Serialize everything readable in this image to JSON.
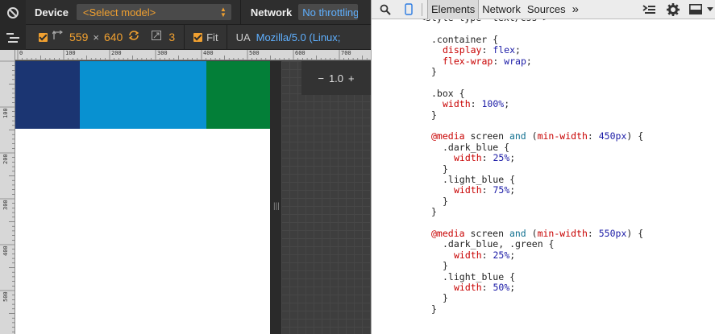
{
  "device_bar": {
    "device_label": "Device",
    "model_select": "<Select model>",
    "network_label": "Network",
    "network_select": "No throttling",
    "width": "559",
    "times": "×",
    "height": "640",
    "scale": "3",
    "fit_label": "Fit",
    "ua_label": "UA",
    "ua_value": "Mozilla/5.0 (Linux;"
  },
  "ruler": {
    "top": [
      "0",
      "100",
      "200",
      "300",
      "400",
      "500",
      "600",
      "700"
    ],
    "left": [
      "100",
      "200",
      "300",
      "400",
      "500"
    ]
  },
  "zoom": {
    "minus": "−",
    "value": "1.0",
    "plus": "+"
  },
  "boxes": [
    {
      "name": "dark_blue",
      "color": "#1b3572"
    },
    {
      "name": "light_blue",
      "color": "#0891d1"
    },
    {
      "name": "green",
      "color": "#037f38"
    }
  ],
  "devtools": {
    "tabs": [
      "Elements",
      "Network",
      "Sources"
    ],
    "more": "»",
    "code_lines": [
      {
        "indent": 4,
        "tokens": [
          [
            "punc",
            "<style type=\"text/css\">"
          ]
        ]
      },
      {
        "indent": 0,
        "tokens": []
      },
      {
        "indent": 6,
        "tokens": [
          [
            "sel",
            ".container {"
          ]
        ]
      },
      {
        "indent": 8,
        "tokens": [
          [
            "prop",
            "display"
          ],
          [
            "punc",
            ": "
          ],
          [
            "val",
            "flex"
          ],
          [
            "punc",
            ";"
          ]
        ]
      },
      {
        "indent": 8,
        "tokens": [
          [
            "prop",
            "flex-wrap"
          ],
          [
            "punc",
            ": "
          ],
          [
            "val",
            "wrap"
          ],
          [
            "punc",
            ";"
          ]
        ]
      },
      {
        "indent": 6,
        "tokens": [
          [
            "punc",
            "}"
          ]
        ]
      },
      {
        "indent": 0,
        "tokens": []
      },
      {
        "indent": 6,
        "tokens": [
          [
            "sel",
            ".box {"
          ]
        ]
      },
      {
        "indent": 8,
        "tokens": [
          [
            "prop",
            "width"
          ],
          [
            "punc",
            ": "
          ],
          [
            "val",
            "100%"
          ],
          [
            "punc",
            ";"
          ]
        ]
      },
      {
        "indent": 6,
        "tokens": [
          [
            "punc",
            "}"
          ]
        ]
      },
      {
        "indent": 0,
        "tokens": []
      },
      {
        "indent": 6,
        "tokens": [
          [
            "at",
            "@media"
          ],
          [
            "punc",
            " screen "
          ],
          [
            "kw",
            "and"
          ],
          [
            "punc",
            " ("
          ],
          [
            "prop",
            "min-width"
          ],
          [
            "punc",
            ": "
          ],
          [
            "val",
            "450px"
          ],
          [
            "punc",
            ") {"
          ]
        ]
      },
      {
        "indent": 8,
        "tokens": [
          [
            "sel",
            ".dark_blue {"
          ]
        ]
      },
      {
        "indent": 10,
        "tokens": [
          [
            "prop",
            "width"
          ],
          [
            "punc",
            ": "
          ],
          [
            "val",
            "25%"
          ],
          [
            "punc",
            ";"
          ]
        ]
      },
      {
        "indent": 8,
        "tokens": [
          [
            "punc",
            "}"
          ]
        ]
      },
      {
        "indent": 8,
        "tokens": [
          [
            "sel",
            ".light_blue {"
          ]
        ]
      },
      {
        "indent": 10,
        "tokens": [
          [
            "prop",
            "width"
          ],
          [
            "punc",
            ": "
          ],
          [
            "val",
            "75%"
          ],
          [
            "punc",
            ";"
          ]
        ]
      },
      {
        "indent": 8,
        "tokens": [
          [
            "punc",
            "}"
          ]
        ]
      },
      {
        "indent": 6,
        "tokens": [
          [
            "punc",
            "}"
          ]
        ]
      },
      {
        "indent": 0,
        "tokens": []
      },
      {
        "indent": 6,
        "tokens": [
          [
            "at",
            "@media"
          ],
          [
            "punc",
            " screen "
          ],
          [
            "kw",
            "and"
          ],
          [
            "punc",
            " ("
          ],
          [
            "prop",
            "min-width"
          ],
          [
            "punc",
            ": "
          ],
          [
            "val",
            "550px"
          ],
          [
            "punc",
            ") {"
          ]
        ]
      },
      {
        "indent": 8,
        "tokens": [
          [
            "sel",
            ".dark_blue, .green {"
          ]
        ]
      },
      {
        "indent": 10,
        "tokens": [
          [
            "prop",
            "width"
          ],
          [
            "punc",
            ": "
          ],
          [
            "val",
            "25%"
          ],
          [
            "punc",
            ";"
          ]
        ]
      },
      {
        "indent": 8,
        "tokens": [
          [
            "punc",
            "}"
          ]
        ]
      },
      {
        "indent": 8,
        "tokens": [
          [
            "sel",
            ".light_blue {"
          ]
        ]
      },
      {
        "indent": 10,
        "tokens": [
          [
            "prop",
            "width"
          ],
          [
            "punc",
            ": "
          ],
          [
            "val",
            "50%"
          ],
          [
            "punc",
            ";"
          ]
        ]
      },
      {
        "indent": 8,
        "tokens": [
          [
            "punc",
            "}"
          ]
        ]
      },
      {
        "indent": 6,
        "tokens": [
          [
            "punc",
            "}"
          ]
        ]
      }
    ]
  }
}
